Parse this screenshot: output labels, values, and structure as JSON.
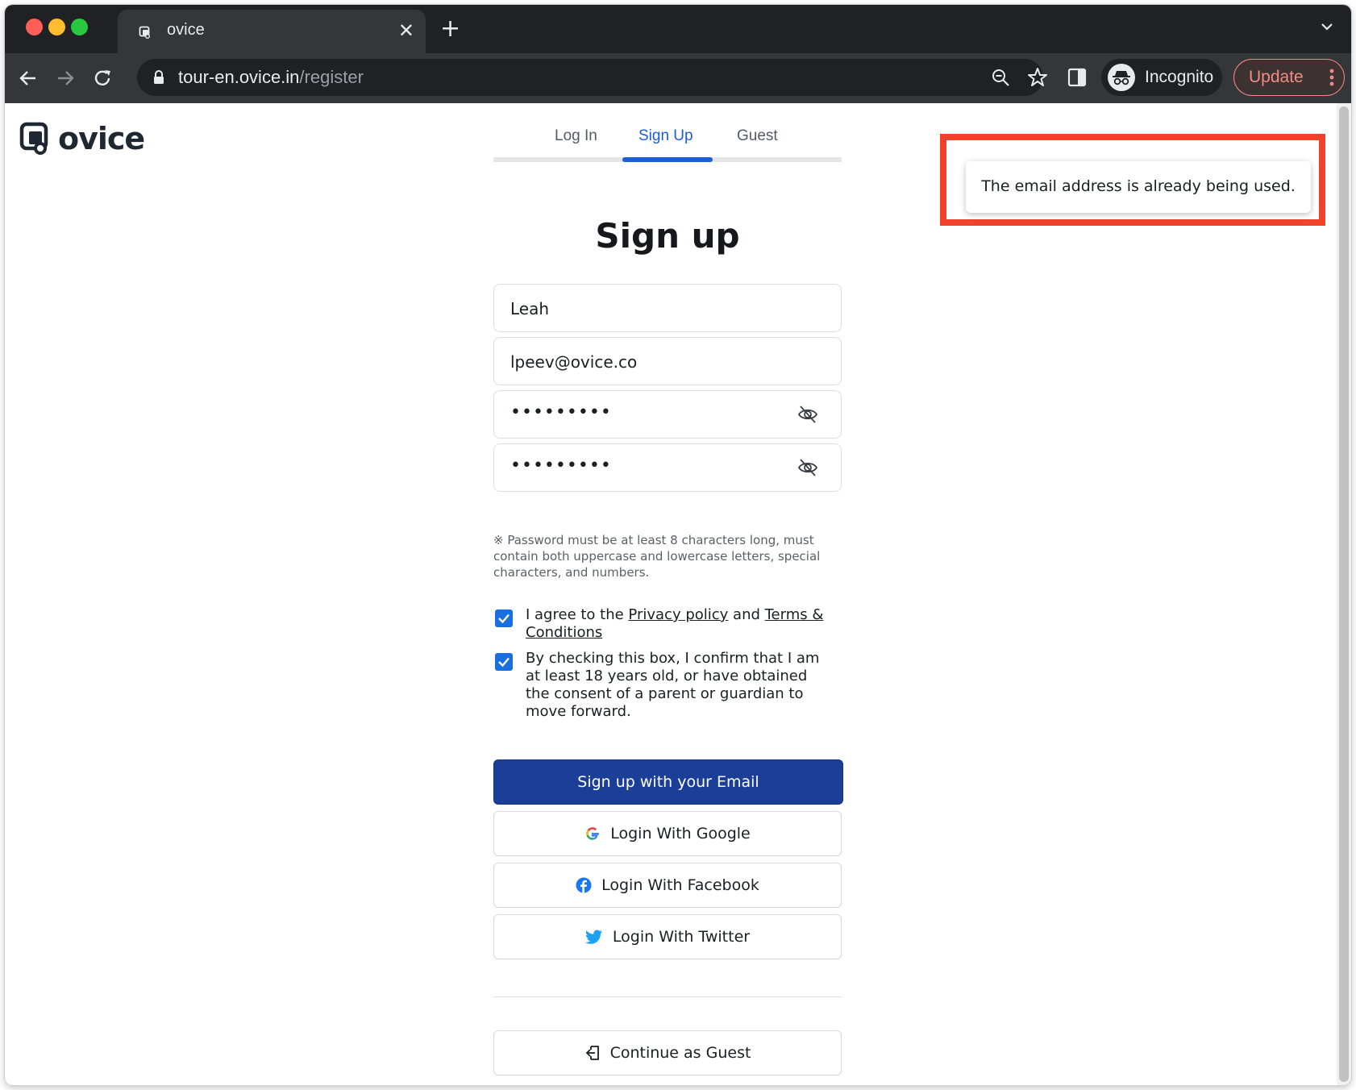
{
  "browser": {
    "tab_title": "ovice",
    "url_host": "tour-en.ovice.in",
    "url_path": "/register",
    "incognito_label": "Incognito",
    "update_label": "Update"
  },
  "brand": {
    "logo_text": "ovice"
  },
  "auth_tabs": [
    {
      "label": "Log In"
    },
    {
      "label": "Sign Up",
      "active": true
    },
    {
      "label": "Guest"
    }
  ],
  "form": {
    "heading": "Sign up",
    "name_value": "Leah",
    "email_value": "lpeev@ovice.co",
    "password_mask": "•••••••••",
    "confirm_password_mask": "•••••••••",
    "password_hint": "※ Password must be at least 8 characters long, must contain both uppercase and lowercase letters, special characters, and numbers.",
    "agree_prefix": "I agree to the ",
    "privacy_link": "Privacy policy",
    "agree_and": " and ",
    "terms_link": "Terms & Conditions",
    "age_confirm": "By checking this box, I confirm that I am at least 18 years old, or have obtained the consent of a parent or guardian to move forward."
  },
  "buttons": {
    "signup_email": "Sign up with your Email",
    "google": "Login With Google",
    "facebook": "Login With Facebook",
    "twitter": "Login With Twitter",
    "guest": "Continue as Guest"
  },
  "toast": {
    "message": "The email address is already being used."
  },
  "colors": {
    "primary": "#1b3f96",
    "tab_active": "#1a5ed8",
    "highlight_border": "#f0412a"
  }
}
